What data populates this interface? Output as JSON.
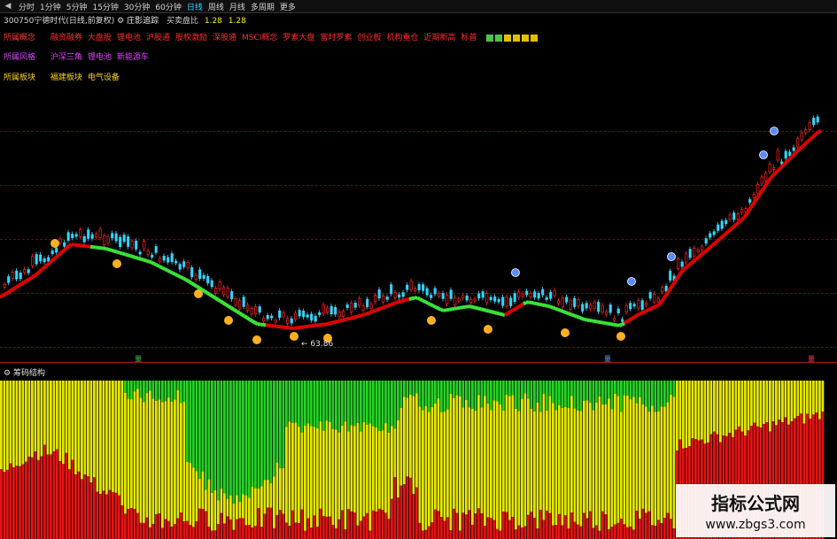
{
  "toolbar": {
    "tabs": [
      "分时",
      "1分钟",
      "5分钟",
      "15分钟",
      "30分钟",
      "60分钟",
      "日线",
      "周线",
      "月线",
      "多周期",
      "更多"
    ],
    "active_index": 6
  },
  "header": {
    "stock": "300750宁德时代(日线,前复权)",
    "indicator": "庄影追踪",
    "ratio_label": "买卖盘比",
    "ratio_value": "1.28",
    "ratio_value2": "1.28"
  },
  "concepts": {
    "label": "所属概念",
    "items": [
      "融资融券",
      "大盘股",
      "锂电池",
      "沪股通",
      "股权激励",
      "深股通",
      "MSCI概念",
      "罗素大盘",
      "富时罗素",
      "创业板",
      "机构重仓",
      "近期新高",
      "标普"
    ]
  },
  "styles": {
    "label": "所属风格",
    "items": [
      "沪深三角",
      "锂电池",
      "新能源车"
    ]
  },
  "blocks": {
    "label": "所属板块",
    "items": [
      "福建板块",
      "电气设备"
    ]
  },
  "sub_panel": {
    "title": "筹码结构"
  },
  "price_marker": {
    "text": "← 63.86"
  },
  "markers": {
    "buy": "买",
    "sell": "卖",
    "vol": "量"
  },
  "watermark": {
    "title": "指标公式网",
    "url": "www.zbgs3.com"
  },
  "colors": {
    "up": "#ff2222",
    "down": "#33d6ff",
    "trend_up": "#e00000",
    "trend_down": "#39e639",
    "chip_red": "#e21414",
    "chip_yellow": "#e6e600",
    "chip_green": "#26d126"
  },
  "concept_squares": [
    "#4fc14f",
    "#4fc14f",
    "#e0c000",
    "#e0c000",
    "#e0c000",
    "#e0c000"
  ]
}
